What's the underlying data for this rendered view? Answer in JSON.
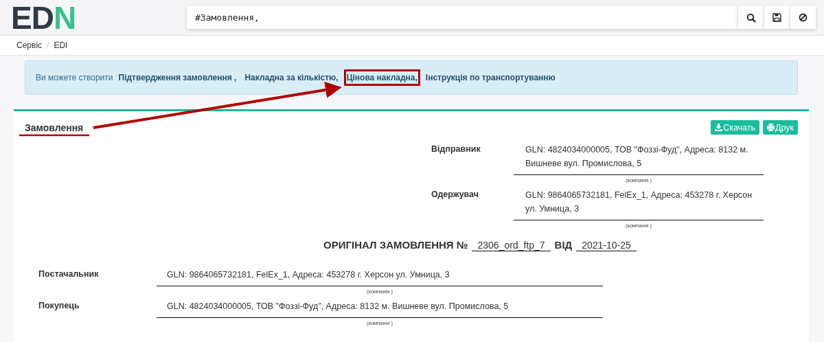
{
  "logo": {
    "part_1": "ED",
    "part_2": "N"
  },
  "search": {
    "value": "#Замовлення,"
  },
  "breadcrumbs": [
    {
      "label": "Сервіс",
      "separator": "/"
    },
    {
      "label": "EDI"
    }
  ],
  "alert": {
    "text": "Ви можете створити",
    "links": [
      {
        "label": "Підтвердження замовлення",
        "separator": " ,",
        "highlighted": false
      },
      {
        "label": "Накладна за кількістю",
        "separator": ",",
        "highlighted": false
      },
      {
        "label": "Цінова накладна",
        "separator": ",",
        "highlighted": true
      },
      {
        "label": "Інструкція по транспортуванню",
        "highlighted": false
      }
    ]
  },
  "card": {
    "title": "Замовлення",
    "buttons": [
      "Скачать",
      "Друк"
    ]
  },
  "parties_top": [
    {
      "label": "Відправник",
      "value": "GLN: 4824034000005, ТОВ \"Фоззі-Фуд\", Адреса: 8132 м. Вишневе вул. Промислова, 5",
      "caption": "(компанія )"
    },
    {
      "label": "Одержувач",
      "value": "GLN: 9864065732181, FelEx_1, Адреса: 453278 г. Херсон ул. Умница, 3",
      "caption": "(компанія )"
    }
  ],
  "document": {
    "title": "ОРИГІНАЛ ЗАМОВЛЕННЯ №",
    "number": "2306_ord_ftp_7",
    "date_label": "ВІД",
    "date": "2021-10-25"
  },
  "parties_bottom": [
    {
      "label": "Постачальник",
      "value": "GLN: 9864065732181, FelEx_1, Адреса: 453278 г. Херсон ул. Умница, 3",
      "caption": "(компанія )"
    },
    {
      "label": "Покупець",
      "value": "GLN: 4824034000005, ТОВ \"Фоззі-Фуд\", Адреса: 8132 м. Вишневе вул. Промислова, 5",
      "caption": "(компанія )"
    }
  ]
}
